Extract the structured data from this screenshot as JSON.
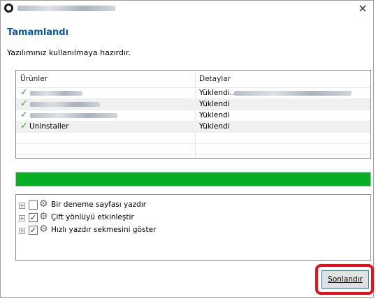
{
  "titlebar": {
    "icon": "app-globe-icon",
    "close_glyph": "×"
  },
  "header": {
    "title": "Tamamlandı",
    "subtitle": "Yazılımınız kullanılmaya hazırdır."
  },
  "product_list": {
    "columns": [
      "Ürünler",
      "Detaylar"
    ],
    "rows": [
      {
        "product": "",
        "status": "Yüklendi..",
        "checked": true
      },
      {
        "product": "",
        "status": "Yüklendi",
        "checked": true
      },
      {
        "product": "",
        "status": "Yüklendi",
        "checked": true
      },
      {
        "product": "Uninstaller",
        "status": "Yüklendi",
        "checked": true
      }
    ],
    "check_color": "#2ea82e"
  },
  "progress": {
    "value": 1.0,
    "color": "#06b025"
  },
  "options": [
    {
      "label": "Bir deneme sayfası yazdır",
      "checked": false
    },
    {
      "label": "Çift yönlüyü etkinleştir",
      "checked": true
    },
    {
      "label": "Hızlı yazdır sekmesini göster",
      "checked": true
    }
  ],
  "footer": {
    "finish_label": "Sonlandır",
    "highlight_color": "#e8101d"
  }
}
